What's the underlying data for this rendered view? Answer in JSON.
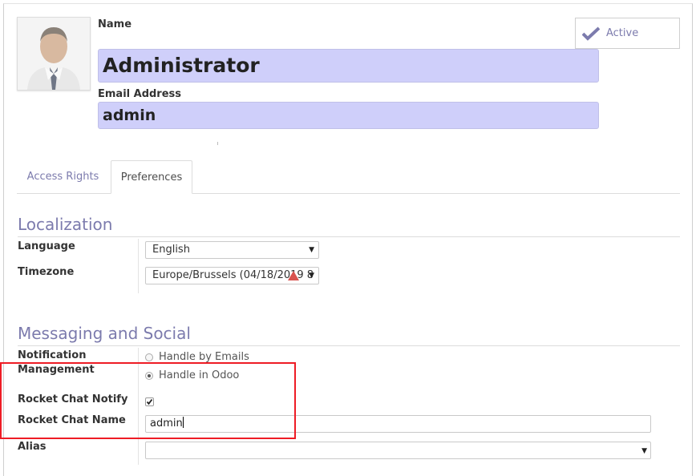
{
  "header": {
    "name_label": "Name",
    "name_value": "Administrator",
    "email_label": "Email Address",
    "email_value": "admin",
    "active_label": "Active"
  },
  "tabs": [
    {
      "label": "Access Rights",
      "active": false
    },
    {
      "label": "Preferences",
      "active": true
    }
  ],
  "localization": {
    "title": "Localization",
    "language_label": "Language",
    "language_value": "English",
    "timezone_label": "Timezone",
    "timezone_value": "Europe/Brussels (04/18/2019 8"
  },
  "messaging": {
    "title": "Messaging and Social",
    "notification_label_1": "Notification",
    "notification_label_2": "Management",
    "option_emails": "Handle by Emails",
    "option_odoo": "Handle in Odoo",
    "selected_option": "Handle in Odoo",
    "rocket_notify_label": "Rocket Chat Notify",
    "rocket_notify_checked": true,
    "rocket_name_label": "Rocket Chat Name",
    "rocket_name_value": "admin",
    "alias_label": "Alias",
    "alias_value": ""
  },
  "colors": {
    "accent": "#7c7bad",
    "highlight_field": "#cfcffa",
    "annotation_box": "#ee1c25",
    "warning_icon": "#d9534f"
  }
}
